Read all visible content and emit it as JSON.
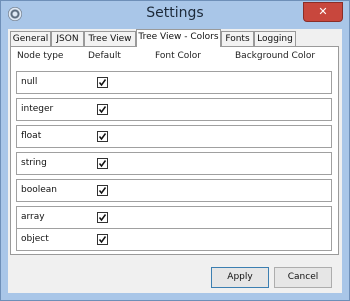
{
  "window": {
    "title": "Settings",
    "close_label": "✕"
  },
  "tabs": [
    {
      "label": "General"
    },
    {
      "label": "JSON"
    },
    {
      "label": "Tree View"
    },
    {
      "label": "Tree View - Colors"
    },
    {
      "label": "Fonts"
    },
    {
      "label": "Logging"
    }
  ],
  "table": {
    "headers": {
      "node_type": "Node type",
      "default": "Default",
      "font_color": "Font Color",
      "background_color": "Background Color"
    },
    "rows": [
      {
        "node_type": "null",
        "default": true
      },
      {
        "node_type": "integer",
        "default": true
      },
      {
        "node_type": "float",
        "default": true
      },
      {
        "node_type": "string",
        "default": true
      },
      {
        "node_type": "boolean",
        "default": true
      },
      {
        "node_type": "array",
        "default": true
      },
      {
        "node_type": "object",
        "default": true
      }
    ]
  },
  "buttons": {
    "apply": "Apply",
    "cancel": "Cancel"
  }
}
